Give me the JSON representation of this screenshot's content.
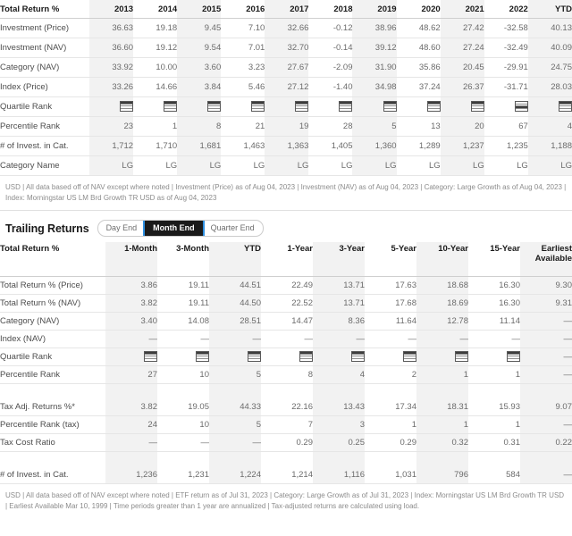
{
  "annual": {
    "header_label": "Total Return %",
    "columns": [
      "2013",
      "2014",
      "2015",
      "2016",
      "2017",
      "2018",
      "2019",
      "2020",
      "2021",
      "2022",
      "YTD"
    ],
    "rows": [
      {
        "label": "Investment (Price)",
        "values": [
          "36.63",
          "19.18",
          "9.45",
          "7.10",
          "32.66",
          "-0.12",
          "38.96",
          "48.62",
          "27.42",
          "-32.58",
          "40.13"
        ]
      },
      {
        "label": "Investment (NAV)",
        "values": [
          "36.60",
          "19.12",
          "9.54",
          "7.01",
          "32.70",
          "-0.14",
          "39.12",
          "48.60",
          "27.24",
          "-32.49",
          "40.09"
        ]
      },
      {
        "label": "Category (NAV)",
        "values": [
          "33.92",
          "10.00",
          "3.60",
          "3.23",
          "27.67",
          "-2.09",
          "31.90",
          "35.86",
          "20.45",
          "-29.91",
          "24.75"
        ]
      },
      {
        "label": "Index (Price)",
        "values": [
          "33.26",
          "14.66",
          "3.84",
          "5.46",
          "27.12",
          "-1.40",
          "34.98",
          "37.24",
          "26.37",
          "-31.71",
          "28.03"
        ]
      }
    ],
    "quartile_row": {
      "label": "Quartile Rank",
      "values": [
        1,
        1,
        1,
        1,
        1,
        1,
        1,
        1,
        1,
        3,
        1
      ]
    },
    "percentile_row": {
      "label": "Percentile Rank",
      "values": [
        "23",
        "1",
        "8",
        "21",
        "19",
        "28",
        "5",
        "13",
        "20",
        "67",
        "4"
      ]
    },
    "count_row": {
      "label": "# of Invest. in Cat.",
      "values": [
        "1,712",
        "1,710",
        "1,681",
        "1,463",
        "1,363",
        "1,405",
        "1,360",
        "1,289",
        "1,237",
        "1,235",
        "1,188"
      ]
    },
    "category_row": {
      "label": "Category Name",
      "values": [
        "LG",
        "LG",
        "LG",
        "LG",
        "LG",
        "LG",
        "LG",
        "LG",
        "LG",
        "LG",
        "LG"
      ]
    },
    "footnote": "USD | All data based off of NAV except where noted | Investment (Price) as of Aug 04, 2023 | Investment (NAV) as of Aug 04, 2023 | Category: Large Growth as of Aug 04, 2023 | Index: Morningstar US LM Brd Growth TR USD as of Aug 04, 2023"
  },
  "trailing": {
    "title": "Trailing Returns",
    "toggle": {
      "options": [
        "Day End",
        "Month End",
        "Quarter End"
      ],
      "selected": "Month End"
    },
    "header_label": "Total Return %",
    "columns": [
      "1-Month",
      "3-Month",
      "YTD",
      "1-Year",
      "3-Year",
      "5-Year",
      "10-Year",
      "15-Year",
      "Earliest Available"
    ],
    "rows": [
      {
        "label": "Total Return % (Price)",
        "values": [
          "3.86",
          "19.11",
          "44.51",
          "22.49",
          "13.71",
          "17.63",
          "18.68",
          "16.30",
          "9.30"
        ]
      },
      {
        "label": "Total Return % (NAV)",
        "values": [
          "3.82",
          "19.11",
          "44.50",
          "22.52",
          "13.71",
          "17.68",
          "18.69",
          "16.30",
          "9.31"
        ]
      },
      {
        "label": "Category (NAV)",
        "values": [
          "3.40",
          "14.08",
          "28.51",
          "14.47",
          "8.36",
          "11.64",
          "12.78",
          "11.14",
          "—"
        ]
      },
      {
        "label": "Index (NAV)",
        "values": [
          "—",
          "—",
          "—",
          "—",
          "—",
          "—",
          "—",
          "—",
          "—"
        ]
      }
    ],
    "quartile_row": {
      "label": "Quartile Rank",
      "values": [
        1,
        1,
        1,
        1,
        1,
        1,
        1,
        1,
        null
      ]
    },
    "percentile_row": {
      "label": "Percentile Rank",
      "values": [
        "27",
        "10",
        "5",
        "8",
        "4",
        "2",
        "1",
        "1",
        "—"
      ]
    },
    "tax_rows": [
      {
        "label": "Tax Adj. Returns %*",
        "values": [
          "3.82",
          "19.05",
          "44.33",
          "22.16",
          "13.43",
          "17.34",
          "18.31",
          "15.93",
          "9.07"
        ]
      },
      {
        "label": "Percentile Rank (tax)",
        "values": [
          "24",
          "10",
          "5",
          "7",
          "3",
          "1",
          "1",
          "1",
          "—"
        ]
      },
      {
        "label": "Tax Cost Ratio",
        "values": [
          "—",
          "—",
          "—",
          "0.29",
          "0.25",
          "0.29",
          "0.32",
          "0.31",
          "0.22"
        ]
      }
    ],
    "count_row": {
      "label": "# of Invest. in Cat.",
      "values": [
        "1,236",
        "1,231",
        "1,224",
        "1,214",
        "1,116",
        "1,031",
        "796",
        "584",
        "—"
      ]
    },
    "footnote": "USD | All data based off of NAV except where noted | ETF return as of Jul 31, 2023 | Category: Large Growth as of Jul 31, 2023 | Index: Morningstar US LM Brd Growth TR USD | Earliest Available Mar 10, 1999 | Time periods greater than 1 year are annualized | Tax-adjusted returns are calculated using load."
  },
  "colors": {
    "accent": "#2e8fe0",
    "shade": "#f2f2f2",
    "text": "#4d4d4d",
    "value_text": "#6b6b6b",
    "header_text": "#1a1a1a"
  }
}
